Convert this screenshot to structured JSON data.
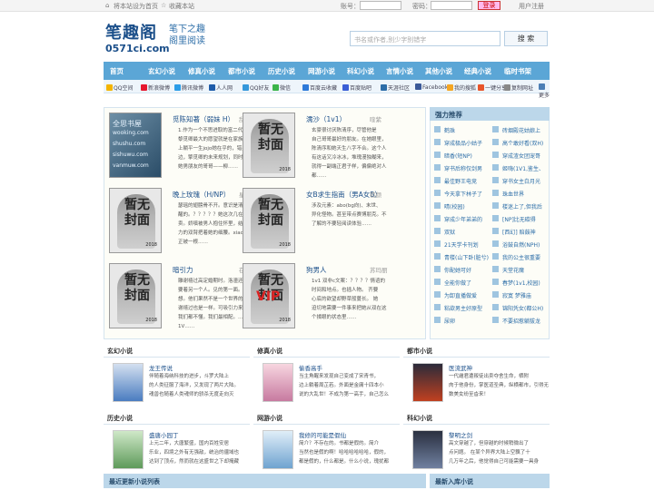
{
  "topbar": {
    "set_home": "将本站设为首页",
    "bookmark": "收藏本站",
    "account_label": "账号：",
    "password_label": "密码：",
    "login": "登录",
    "register": "用户注册"
  },
  "logo": {
    "main": "笔趣阁",
    "site": "0571ci.com",
    "slogan1": "笔下之趣",
    "slogan2": "阁里阅读"
  },
  "search": {
    "placeholder": "书名或作者,别少字别错字",
    "button": "搜 索"
  },
  "nav": [
    "首页",
    "玄幻小说",
    "修真小说",
    "都市小说",
    "历史小说",
    "网游小说",
    "科幻小说",
    "言情小说",
    "其他小说",
    "经典小说",
    "临时书架"
  ],
  "share": [
    "QQ空间",
    "新浪微博",
    "腾讯微博",
    "人人网",
    "QQ好友",
    "微信",
    "百度云收藏",
    "百度贴吧",
    "天涯社区",
    "Facebook",
    "我的搜狐",
    "一键分享",
    "复制网址",
    "更多"
  ],
  "share_colors": [
    "#f4b400",
    "#e6162d",
    "#2b9de8",
    "#1f5ca9",
    "#3598db",
    "#3bb44a",
    "#2e7ad9",
    "#3a5ed6",
    "#2d6ea8",
    "#3b5998",
    "#f5a623",
    "#e8552b",
    "#888888",
    "#4d7fb5"
  ],
  "featured": [
    {
      "title": "觅陈知著（弱妹 H）",
      "author": "乱世音",
      "desc": [
        "1.作为一个不思进取的富二代，",
        "黎觅卿最大的愿望就是在家族财富",
        "上躺平一生jojo她在乎的，错买新",
        "边，擎觅卿的未来规划，同时也是",
        "她男朋友的哥哥——柳……"
      ]
    },
    {
      "title": "濡沙（1v1）",
      "author": "喹紫",
      "desc": [
        "玄豪很讨厌陈清序，尽管他是",
        "自己哥哥最好的朋友。在她眼里，",
        "陈清序和她天生八字不合。这个人",
        "有这话又冷冰冰，堆瑰漫独糊来，",
        "就得一副端正君子样，偏偏绝对人",
        "都……"
      ]
    },
    {
      "title": "晚上玫瑰（H/NP）",
      "author": "星夏兔",
      "desc": [
        "瑟瑶的翅膀骨不开。意识是清",
        "醒的。？？？？？她这次几在读是坐",
        "卖。娇嗔被男人抱住怀里，结实有",
        "力的双臂把着她的细腰。xiaoxue里",
        "正被一根……"
      ]
    },
    {
      "title": "女B求生指南（男A女B）",
      "author": "蓓颜",
      "desc": [
        "涉及元素：abo(bg向)、末世、",
        "异化怪物。甚至带点赛博朋克。不",
        "了解的不要轻阅读体验……"
      ]
    },
    {
      "title": "暗引力",
      "author": "在言外",
      "desc": [
        "雕谢禧过高定婚期时。洛潼还",
        "要着另一个人。见的第一面。洛潼",
        "想。他们果然不是一个世界的人。",
        "谢禧过也是一样。可吸引力来解。",
        "我们都不懂。我们最相配。……",
        "1V……"
      ]
    },
    {
      "title": "狗男人",
      "author": "苏玛丽",
      "desc": [
        "1v1 双非c文案：？？？？情谊的",
        "时间和地点。也插人物。    齐要",
        "心底的欲望却野草般蔓长。    她",
        "迫切地需要一件事来把她从双在这",
        "个揉眼的状态里……"
      ]
    }
  ],
  "rank": {
    "title": "强力推荐",
    "items": [
      "鹤珠",
      "砖烟殿花姑娘上",
      "穿成极品小姑子",
      "高个敢好看(双H)",
      "暗香(短NP)",
      "穿成渣女团宠哥",
      "穿书后称仅剑男",
      "姬嗨(1V1,鉴生、",
      "最佳野王电竞",
      "穿书女主白月光",
      "今天拿下林子了",
      "珠血世界",
      "晴(校园)",
      "楼迷上了,但我后",
      "穿成少年弟弟的",
      "[NP]比无碳得",
      "双狱",
      "[西幻] 赔鼓神",
      "21天学卡刊划",
      "浴鼓自燃(NPH)",
      "青楼(山下卧(脏兮)",
      "我的公主很重要",
      "你配她可好",
      "天堂花魔",
      "全能你做了",
      "春梦(1v1,校园)",
      "为卸直播做爱",
      "寂寞 梦雅庙",
      "粘欲男主好原型",
      "锦阳凭女(都公H)",
      "尿卵",
      "不要招惹躺拔龙"
    ]
  },
  "sections": [
    {
      "name": "玄幻小说",
      "book": "龙王传说",
      "desc": [
        "伴随着海纳科技的进步，斗罗大陆上",
        "的人类征服了海洋，又发现了两片大陆。",
        "魂兽也随着人类魂师的骄杀无度走向灭"
      ]
    },
    {
      "name": "修真小说",
      "book": "偷香高手",
      "desc": [
        "当主角醒来发现自己变成了宋青书，",
        "边上躺着周芷若。外面是金庸十四本小",
        "说的大乱世！不成为第一高手，自己怎么"
      ]
    },
    {
      "name": "都市小说",
      "book": "医流武神",
      "desc": [
        "一代雌君遭叛徒出卖夺舍生命，栖附",
        "肉于他身份，掌医道圣典，纵横都市，引得无",
        "数美女纷至沓来！"
      ]
    },
    {
      "name": "历史小说",
      "book": "盛唐小园丁",
      "desc": [
        "上元二年，大唐繁盛，国内百姓安居",
        "乐业，四境之外有无强敌，统治的疆域也",
        "达到了顶点，然而就在这盛世之下却掩藏"
      ]
    },
    {
      "name": "网游小说",
      "book": "我修的可能是假仙",
      "desc": [
        "简介？不存在的。书都是假的。简介",
        "当然也是假的啊！哈哈哈哈哈哈，假的，",
        "都是假的，什么都是。什么小说，瑰扰都"
      ]
    },
    {
      "name": "科幻小说",
      "book": "黎明之剑",
      "desc": [
        "高文穿越了，但穿越的时候稍微出了",
        "点问题。    在某个异界大陆上空飘了十",
        "几万年之后，他觉得自己可能需要一具身"
      ]
    }
  ],
  "bottom": {
    "latest": "最近更新小说列表",
    "new_in": "最新入库小说"
  },
  "covers": {
    "noimg_text": "暂无封面",
    "year": "2018",
    "vip": "VIP",
    "wm1": "全思书屋",
    "wm2": "wooking.com",
    "wm3": "shushu.com",
    "wm4": "sishuwu.com",
    "wm5": "vanmuw.com"
  }
}
